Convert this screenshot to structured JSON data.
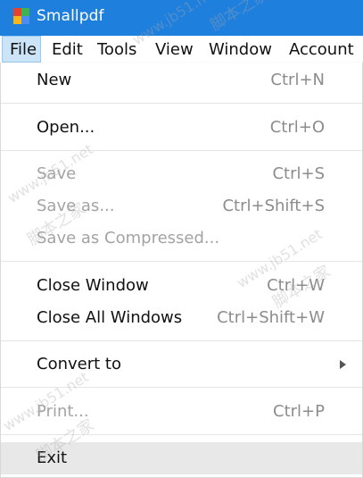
{
  "app": {
    "title": "Smallpdf",
    "icon_colors": [
      "#e8412c",
      "#3fb34f",
      "#f7b614",
      "#4a8cf0"
    ],
    "accent": "#1f7fdd"
  },
  "menubar": {
    "items": [
      "File",
      "Edit",
      "Tools",
      "View",
      "Window",
      "Account"
    ],
    "active": "File"
  },
  "file_menu": {
    "new": {
      "label": "New",
      "shortcut": "Ctrl+N",
      "enabled": true
    },
    "open": {
      "label": "Open...",
      "shortcut": "Ctrl+O",
      "enabled": true
    },
    "save": {
      "label": "Save",
      "shortcut": "Ctrl+S",
      "enabled": false
    },
    "save_as": {
      "label": "Save as...",
      "shortcut": "Ctrl+Shift+S",
      "enabled": false
    },
    "save_as_compressed": {
      "label": "Save as Compressed...",
      "shortcut": "",
      "enabled": false
    },
    "close_window": {
      "label": "Close Window",
      "shortcut": "Ctrl+W",
      "enabled": true
    },
    "close_all_windows": {
      "label": "Close All Windows",
      "shortcut": "Ctrl+Shift+W",
      "enabled": true
    },
    "convert_to": {
      "label": "Convert to",
      "submenu": true,
      "enabled": true
    },
    "print": {
      "label": "Print...",
      "shortcut": "Ctrl+P",
      "enabled": false
    },
    "exit": {
      "label": "Exit",
      "enabled": true,
      "highlighted": true
    }
  },
  "watermark": [
    "脚本之家",
    "www.jb51.net"
  ]
}
